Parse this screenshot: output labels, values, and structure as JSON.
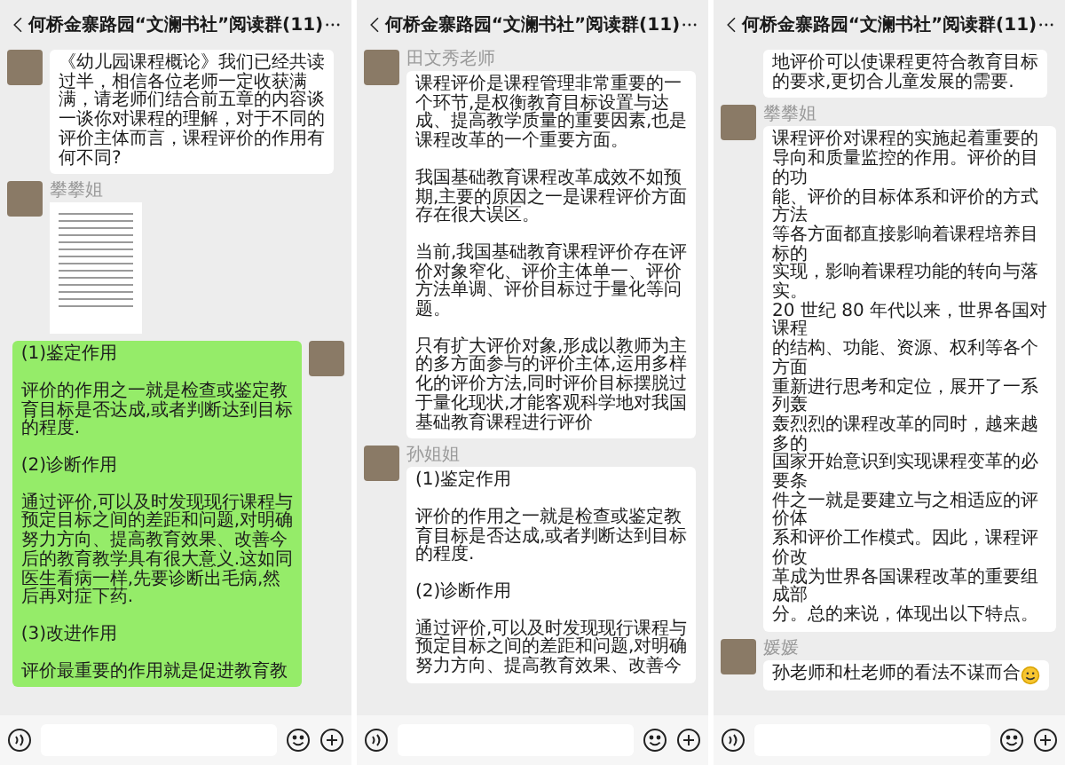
{
  "panels": [
    {
      "title": "何桥金寨路园“文澜书社”阅读群(11)",
      "messages": [
        {
          "kind": "text",
          "sent": false,
          "avatar": true,
          "paragraphs": [
            [
              "《幼儿园课程概论》我们已经共读",
              "过半，相信各位老师一定收获满",
              "满，请老师们结合前五章的内容谈",
              "一谈你对课程的理解，对于不同的",
              "评价主体而言，课程评价的作用有",
              "何不同?"
            ]
          ]
        },
        {
          "kind": "image",
          "sent": false,
          "avatar": true,
          "sender": "攀攀姐"
        },
        {
          "kind": "text",
          "sent": true,
          "avatar": true,
          "paragraphs": [
            [
              "(1)鉴定作用"
            ],
            [
              "评价的作用之一就是检查或鉴定教",
              "育目标是否达成,或者判断达到目标",
              "的程度."
            ],
            [
              "(2)诊断作用"
            ],
            [
              "通过评价,可以及时发现现行课程与",
              "预定目标之间的差距和问题,对明确",
              "努力方向、提高教育效果、改善今",
              "后的教育教学具有很大意义.这如同",
              "医生看病一样,先要诊断出毛病,然",
              "后再对症下药."
            ],
            [
              "(3)改进作用"
            ],
            [
              "评价最重要的作用就是促进教育教"
            ]
          ]
        }
      ]
    },
    {
      "title": "何桥金寨路园“文澜书社”阅读群(11)",
      "messages": [
        {
          "kind": "text",
          "sent": false,
          "avatar": true,
          "sender": "田文秀老师",
          "paragraphs": [
            [
              "课程评价是课程管理非常重要的一",
              "个环节,是权衡教育目标设置与达",
              "成、提高教学质量的重要因素,也是",
              "课程改革的一个重要方面。"
            ],
            [
              "我国基础教育课程改革成效不如预",
              "期,主要的原因之一是课程评价方面",
              "存在很大误区。"
            ],
            [
              "当前,我国基础教育课程评价存在评",
              "价对象窄化、评价主体单一、评价",
              "方法单调、评价目标过于量化等问",
              "题。"
            ],
            [
              "只有扩大评价对象,形成以教师为主",
              "的多方面参与的评价主体,运用多样",
              "化的评价方法,同时评价目标摆脱过",
              "于量化现状,才能客观科学地对我国",
              "基础教育课程进行评价"
            ]
          ]
        },
        {
          "kind": "text",
          "sent": false,
          "avatar": true,
          "sender": "孙姐姐",
          "paragraphs": [
            [
              "(1)鉴定作用"
            ],
            [
              "评价的作用之一就是检查或鉴定教",
              "育目标是否达成,或者判断达到目标",
              "的程度."
            ],
            [
              "(2)诊断作用"
            ],
            [
              "通过评价,可以及时发现现行课程与",
              "预定目标之间的差距和问题,对明确",
              "努力方向、提高教育效果、改善今"
            ]
          ]
        }
      ]
    },
    {
      "title": "何桥金寨路园“文澜书社”阅读群(11)",
      "messages": [
        {
          "kind": "text",
          "sent": false,
          "avatar": false,
          "paragraphs": [
            [
              "地评价可以使课程更符合教育目标",
              "的要求,更切合儿童发展的需要."
            ]
          ]
        },
        {
          "kind": "text",
          "sent": false,
          "avatar": true,
          "sender": "攀攀姐",
          "paragraphs": [
            [
              "课程评价对课程的实施起着重要的",
              "导向和质量监控的作用。评价的目",
              "的功",
              "能、评价的目标体系和评价的方式",
              "方法",
              "等各方面都直接影响着课程培养目",
              "标的",
              "实现，影响着课程功能的转向与落",
              "实。",
              "20 世纪 80 年代以来，世界各国对",
              "课程",
              "的结构、功能、资源、权利等各个",
              "方面",
              "重新进行思考和定位，展开了一系",
              "列轰",
              "轰烈烈的课程改革的同时，越来越",
              "多的",
              "国家开始意识到实现课程变革的必",
              "要条",
              "件之一就是要建立与之相适应的评",
              "价体",
              "系和评价工作模式。因此，课程评",
              "价改",
              "革成为世界各国课程改革的重要组",
              "成部",
              "分。总的来说，体现出以下特点。"
            ]
          ]
        },
        {
          "kind": "text",
          "sent": false,
          "avatar": true,
          "sender": "媛媛",
          "emoji": true,
          "paragraphs": [
            [
              "孙老师和杜老师的看法不谋而合"
            ]
          ]
        }
      ]
    }
  ]
}
